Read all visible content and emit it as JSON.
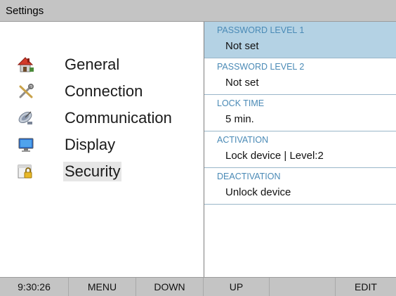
{
  "window": {
    "title": "Settings"
  },
  "menu": {
    "items": [
      {
        "label": "General",
        "icon": "house-icon"
      },
      {
        "label": "Connection",
        "icon": "tools-icon"
      },
      {
        "label": "Communication",
        "icon": "satellite-dish-icon"
      },
      {
        "label": "Display",
        "icon": "monitor-icon"
      },
      {
        "label": "Security",
        "icon": "lock-folder-icon",
        "selected": true
      }
    ]
  },
  "settings": [
    {
      "header": "PASSWORD LEVEL 1",
      "value": "Not set",
      "selected": true
    },
    {
      "header": "PASSWORD LEVEL 2",
      "value": "Not set"
    },
    {
      "header": "LOCK TIME",
      "value": "5 min."
    },
    {
      "header": "ACTIVATION",
      "value": "Lock device | Level:2"
    },
    {
      "header": "DEACTIVATION",
      "value": "Unlock device"
    }
  ],
  "bottombar": {
    "time": "9:30:26",
    "keys": [
      "MENU",
      "DOWN",
      "UP",
      "",
      "EDIT"
    ]
  },
  "colors": {
    "header_text": "#4a8ab6",
    "selected_bg": "#b4d2e4",
    "bar_bg": "#c4c4c4"
  }
}
